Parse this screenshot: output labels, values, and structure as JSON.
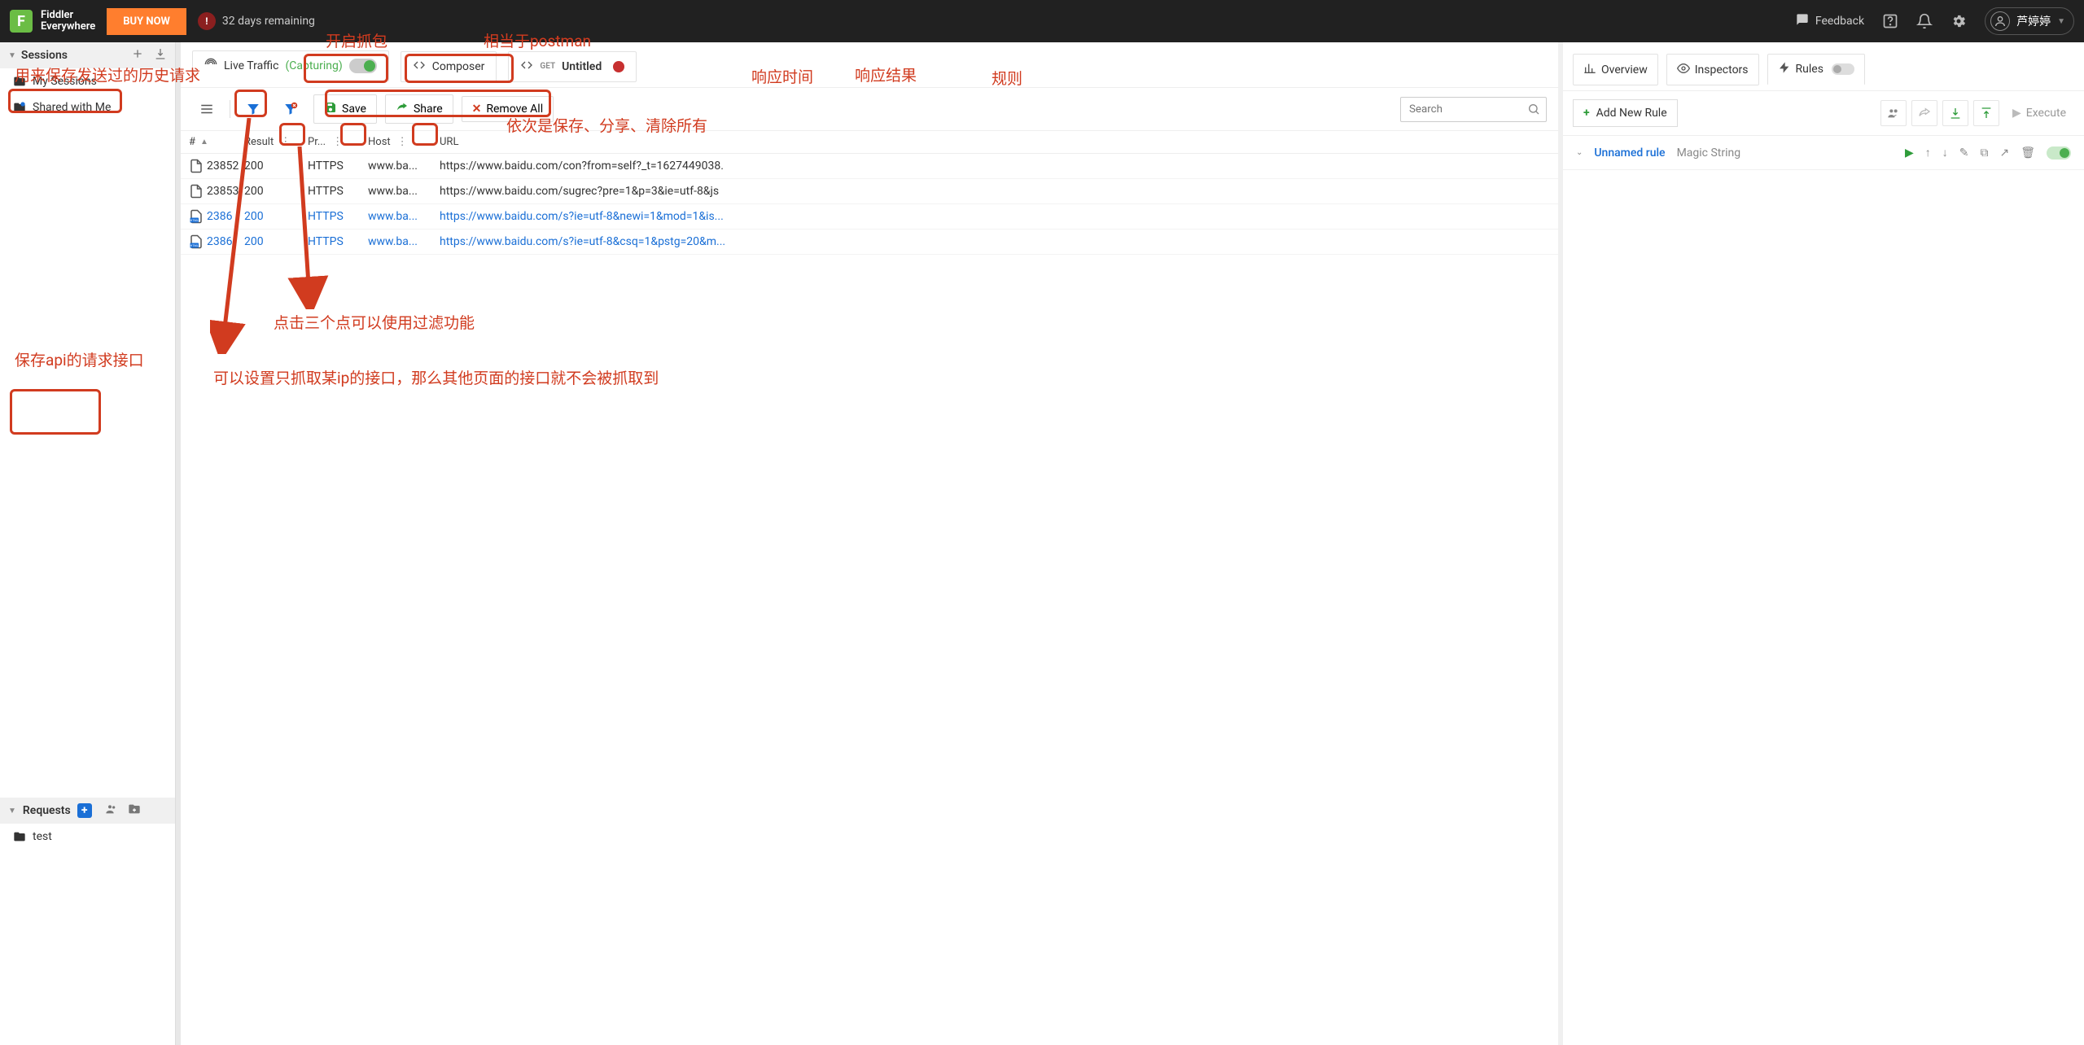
{
  "header": {
    "app_name_line1": "Fiddler",
    "app_name_line2": "Everywhere",
    "buy_now": "BUY NOW",
    "trial_days": "32 days remaining",
    "feedback": "Feedback",
    "user_name": "芦婷婷"
  },
  "sidebar": {
    "sessions_label": "Sessions",
    "my_sessions": "My Sessions",
    "shared_with_me": "Shared with Me",
    "requests_label": "Requests",
    "test_folder": "test"
  },
  "tabs": {
    "live_traffic": "Live Traffic",
    "capturing": "(Capturing)",
    "composer": "Composer",
    "get_label": "GET",
    "untitled": "Untitled"
  },
  "toolbar": {
    "save": "Save",
    "share": "Share",
    "remove_all": "Remove All",
    "search_placeholder": "Search"
  },
  "columns": {
    "id": "#",
    "result": "Result",
    "protocol": "Pr...",
    "host": "Host",
    "url": "URL"
  },
  "rows": [
    {
      "id": "23852",
      "result": "200",
      "protocol": "HTTPS",
      "host": "www.ba...",
      "url": "https://www.baidu.com/con?from=self?_t=1627449038.",
      "link": false,
      "html": false
    },
    {
      "id": "23853",
      "result": "200",
      "protocol": "HTTPS",
      "host": "www.ba...",
      "url": "https://www.baidu.com/sugrec?pre=1&p=3&ie=utf-8&js",
      "link": false,
      "html": false
    },
    {
      "id": "2386",
      "result": "200",
      "protocol": "HTTPS",
      "host": "www.ba...",
      "url": "https://www.baidu.com/s?ie=utf-8&newi=1&mod=1&is...",
      "link": true,
      "html": true
    },
    {
      "id": "2386",
      "result": "200",
      "protocol": "HTTPS",
      "host": "www.ba...",
      "url": "https://www.baidu.com/s?ie=utf-8&csq=1&pstg=20&m...",
      "link": true,
      "html": true
    }
  ],
  "right": {
    "overview": "Overview",
    "inspectors": "Inspectors",
    "rules": "Rules",
    "add_rule": "Add New Rule",
    "execute": "Execute",
    "rule_name": "Unnamed rule",
    "rule_type": "Magic String"
  },
  "annotations": {
    "anno_history": "用来保存发送过的历史请求",
    "anno_capture": "开启抓包",
    "anno_postman": "相当于postman",
    "anno_save_share_remove": "依次是保存、分享、清除所有",
    "anno_resp_time": "响应时间",
    "anno_resp_result": "响应结果",
    "anno_rules": "规则",
    "anno_filter_dots": "点击三个点可以使用过滤功能",
    "anno_ip_filter": "可以设置只抓取某ip的接口，那么其他页面的接口就不会被抓取到",
    "anno_save_api": "保存api的请求接口"
  }
}
